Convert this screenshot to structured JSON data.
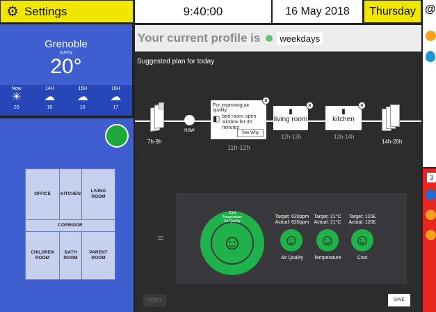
{
  "header": {
    "settings_label": "Settings",
    "time": "9:40:00",
    "date": "16 May 2018",
    "day": "Thursday"
  },
  "weather": {
    "city": "Grenoble",
    "condition": "sunny",
    "temperature": "20°",
    "forecast": [
      {
        "time": "Now",
        "icon": "sun-icon",
        "temp": "20"
      },
      {
        "time": "14H",
        "icon": "cloud-icon",
        "temp": "18"
      },
      {
        "time": "15H",
        "icon": "cloud-icon",
        "temp": "16"
      },
      {
        "time": "16H",
        "icon": "cloud-icon",
        "temp": "17"
      }
    ]
  },
  "floorplan": {
    "rooms": {
      "office": "OFFICE",
      "kitchen": "KITCHEN",
      "living": "LIVING ROOM",
      "corridor": "CORRIDOR",
      "children": "CHILDREN ROOM",
      "bath": "BATH ROOM",
      "parent": "PARENT ROOM"
    },
    "status_color": "#1ca83b"
  },
  "profile": {
    "prefix": "Your current profile is",
    "name": "weekdays",
    "dot_color": "#5fc474"
  },
  "plan": {
    "title": "Suggested plan for today",
    "start_label": "7h-9h",
    "now_label": "now",
    "card1": {
      "title": "For improving air quality",
      "text": "bed room: open window for 30 minutes",
      "button": "See Why",
      "time": "11h-12h"
    },
    "card2": {
      "text": "living room",
      "time": "12h-13h"
    },
    "card3": {
      "text": "kitchen",
      "time": "13h-14h"
    },
    "end_label": "14h-20h"
  },
  "evaluation": {
    "overall_labels": [
      "Cost",
      "Temperature",
      "Air Quality"
    ],
    "metrics": [
      {
        "target": "Target: 620ppm",
        "actual": "Actual: 620ppm",
        "name": "Air Quality"
      },
      {
        "target": "Target: 21°C",
        "actual": "Actual: 21°C",
        "name": "Temperature"
      },
      {
        "target": "Target: 120£",
        "actual": "Actual: 120£",
        "name": "Cost"
      }
    ],
    "good_color": "#1fb24a"
  },
  "buttons": {
    "reset": "RESET",
    "save": "SAVE"
  },
  "rail": {
    "badge": "3"
  }
}
